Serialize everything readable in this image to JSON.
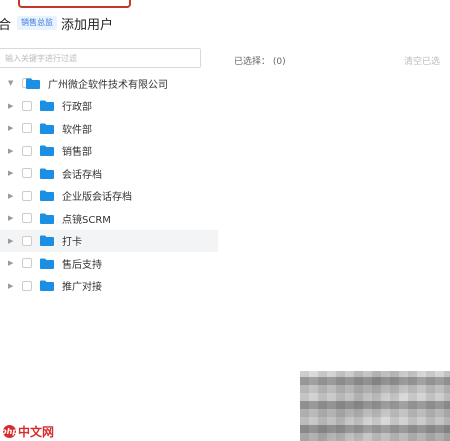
{
  "header": {
    "prefix": "合",
    "tag": "销售总监",
    "title": "添加用户"
  },
  "search": {
    "placeholder": "输入关键字进行过滤"
  },
  "selection": {
    "selected_text": "已选择： (0)",
    "clear_text": "清空已选"
  },
  "tree": {
    "root": {
      "label": "广州微企软件技术有限公司"
    },
    "children": [
      {
        "label": "行政部"
      },
      {
        "label": "软件部"
      },
      {
        "label": "销售部"
      },
      {
        "label": "会话存档"
      },
      {
        "label": "企业版会话存档"
      },
      {
        "label": "点镜SCRM"
      },
      {
        "label": "打卡"
      },
      {
        "label": "售后支持"
      },
      {
        "label": "推广对接"
      }
    ]
  },
  "watermark": {
    "badge": "php",
    "text": "中文网"
  },
  "colors": {
    "folder": "#1a8fe3",
    "tag_bg": "#e9f2ff",
    "tag_text": "#3a7ad9",
    "frame_border": "#c0392b",
    "hover_row": "#f3f4f6"
  }
}
